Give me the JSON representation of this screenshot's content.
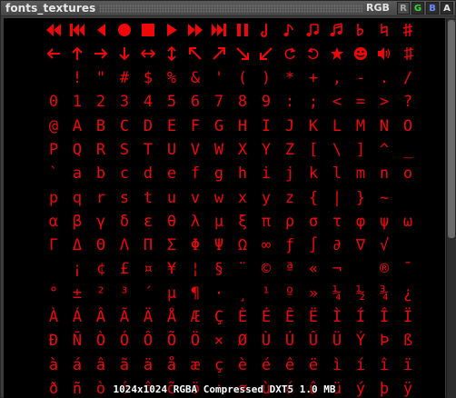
{
  "window": {
    "title": "fonts_textures",
    "channel_mode": "RGB",
    "channels": [
      "R",
      "G",
      "B",
      "A"
    ]
  },
  "status": {
    "info": "1024x1024 RGBA Compressed DXT5 1.0 MB"
  },
  "colors": {
    "glyph": "#f00808",
    "background": "#000000",
    "titlebar": "#4f4f4f",
    "channel_g": "#3cd83c",
    "channel_b": "#6a8cff"
  },
  "icon_row_0": [
    "rewind-end-icon",
    "rewind-icon",
    "step-back-icon",
    "record-icon",
    "stop-icon",
    "play-icon",
    "fast-forward-icon",
    "skip-end-icon",
    "pause-icon",
    "eject-icon",
    "repeat-icon",
    "shuffle-icon",
    "music-note-icon",
    "beamed-note-icon",
    "two-notes-icon",
    "flat-icon",
    "natural-icon",
    "sharp-icon"
  ],
  "icon_row_1": [
    "arrow-left-icon",
    "arrow-up-icon",
    "arrow-right-icon",
    "arrow-down-icon",
    "arrow-left-right-icon",
    "arrow-up-down-icon",
    "arrow-up-left-icon",
    "arrow-up-right-icon",
    "arrow-down-right-icon",
    "arrow-down-left-icon",
    "cycle-left-icon",
    "curl-right-icon",
    "reload-icon",
    "circle-arrow-icon",
    "star-icon",
    "smiley-icon",
    "speaker-icon",
    "square-icon"
  ],
  "glyph_rows": [
    [
      "",
      "!",
      "\"",
      "#",
      "$",
      "%",
      "&",
      "'",
      "(",
      ")",
      "*",
      "+",
      ",",
      "-",
      ".",
      "/"
    ],
    [
      "0",
      "1",
      "2",
      "3",
      "4",
      "5",
      "6",
      "7",
      "8",
      "9",
      ":",
      ";",
      "<",
      "=",
      ">",
      "?"
    ],
    [
      "@",
      "A",
      "B",
      "C",
      "D",
      "E",
      "F",
      "G",
      "H",
      "I",
      "J",
      "K",
      "L",
      "M",
      "N",
      "O"
    ],
    [
      "P",
      "Q",
      "R",
      "S",
      "T",
      "U",
      "V",
      "W",
      "X",
      "Y",
      "Z",
      "[",
      "\\",
      "]",
      "^",
      "_"
    ],
    [
      "`",
      "a",
      "b",
      "c",
      "d",
      "e",
      "f",
      "g",
      "h",
      "i",
      "j",
      "k",
      "l",
      "m",
      "n",
      "o"
    ],
    [
      "p",
      "q",
      "r",
      "s",
      "t",
      "u",
      "v",
      "w",
      "x",
      "y",
      "z",
      "{",
      "|",
      "}",
      "~",
      ""
    ],
    [
      "α",
      "β",
      "γ",
      "δ",
      "ε",
      "θ",
      "λ",
      "μ",
      "ξ",
      "π",
      "ρ",
      "σ",
      "τ",
      "φ",
      "ψ",
      "ω"
    ],
    [
      "Γ",
      "Δ",
      "Θ",
      "Λ",
      "Π",
      "Σ",
      "Φ",
      "Ψ",
      "Ω",
      "∞",
      "ƒ",
      "∫",
      "∂",
      "∇",
      "√",
      ""
    ],
    [
      "",
      "¡",
      "¢",
      "£",
      "¤",
      "¥",
      "¦",
      "§",
      "¨",
      "©",
      "ª",
      "«",
      "¬",
      "",
      "®",
      "¯"
    ],
    [
      "°",
      "±",
      "²",
      "³",
      "´",
      "µ",
      "¶",
      "·",
      "¸",
      "¹",
      "º",
      "»",
      "¼",
      "½",
      "¾",
      "¿"
    ],
    [
      "À",
      "Á",
      "Â",
      "Ã",
      "Ä",
      "Å",
      "Æ",
      "Ç",
      "È",
      "É",
      "Ê",
      "Ë",
      "Ì",
      "Í",
      "Î",
      "Ï"
    ],
    [
      "Ð",
      "Ñ",
      "Ò",
      "Ó",
      "Ô",
      "Õ",
      "Ö",
      "×",
      "Ø",
      "Ù",
      "Ú",
      "Û",
      "Ü",
      "Ý",
      "Þ",
      "ß"
    ],
    [
      "à",
      "á",
      "â",
      "ã",
      "ä",
      "å",
      "æ",
      "ç",
      "è",
      "é",
      "ê",
      "ë",
      "ì",
      "í",
      "î",
      "ï"
    ],
    [
      "ð",
      "ñ",
      "ò",
      "ó",
      "ô",
      "õ",
      "ö",
      "÷",
      "ø",
      "ù",
      "ú",
      "û",
      "ü",
      "ý",
      "þ",
      "ÿ"
    ]
  ]
}
